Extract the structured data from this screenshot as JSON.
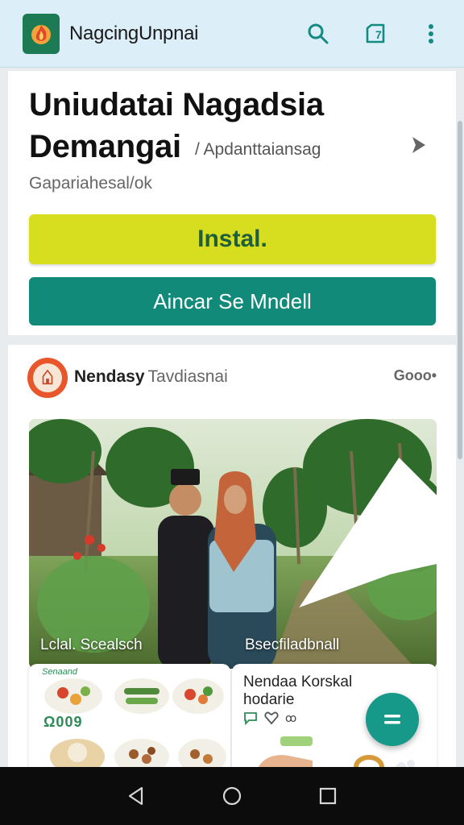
{
  "appbar": {
    "title": "NagcingUnpnai",
    "search_icon": "search-icon",
    "share_icon": "calendar-share-icon",
    "share_badge": "7",
    "more_icon": "more-vert-icon"
  },
  "install_card": {
    "app_name": "Uniudatai Nagadsia Demangai",
    "category": "/ Apdanttaiansag",
    "subtitle": "Gapariahesal/ok",
    "install_label": "Instal.",
    "secondary_label": "Aincar Se Mndell"
  },
  "post": {
    "author": "Nendasy",
    "author_sub": "Tavdiasnai",
    "more_label": "Gooo•",
    "photo_caption_left": "Lclal. Scealsch",
    "photo_caption_right": "Bsecfiladbnall",
    "food_tile": {
      "label": "Senaand",
      "code": "Ω009"
    },
    "recipe_tile": {
      "title": "Nendaa Korskal hodarie",
      "icon_text": "ꝏ"
    }
  },
  "colors": {
    "appbar_bg": "#dceef8",
    "install_btn": "#d6de1f",
    "secondary_btn": "#128a7a",
    "accent": "#17998a"
  }
}
